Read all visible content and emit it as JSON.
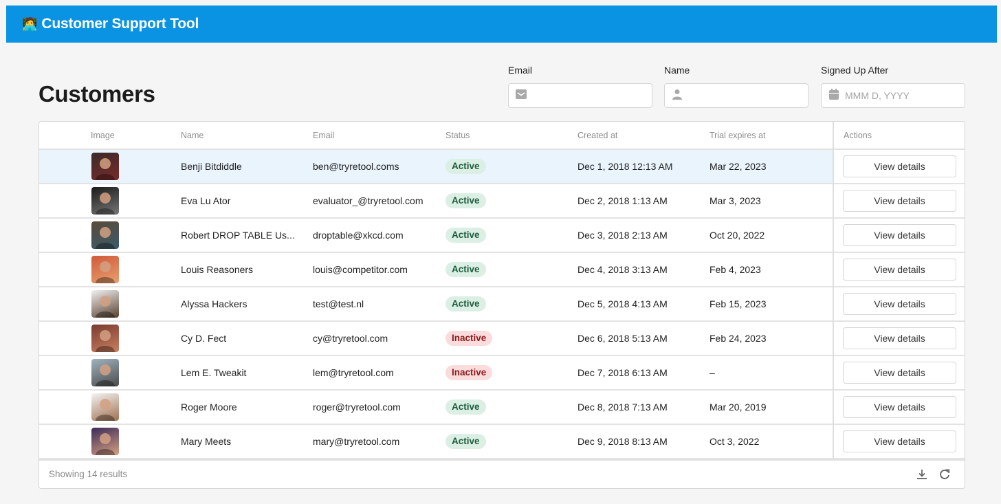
{
  "app": {
    "emoji": "🧑‍💻",
    "title": "Customer Support Tool",
    "header_color": "#0b93e3"
  },
  "page": {
    "title": "Customers"
  },
  "filters": {
    "email": {
      "label": "Email",
      "value": "",
      "placeholder": "",
      "icon": "mail-icon"
    },
    "name": {
      "label": "Name",
      "value": "",
      "placeholder": "",
      "icon": "user-icon"
    },
    "signed_up_after": {
      "label": "Signed Up After",
      "value": "",
      "placeholder": "MMM D, YYYY",
      "icon": "calendar-icon"
    }
  },
  "table": {
    "columns": {
      "image": "Image",
      "name": "Name",
      "email": "Email",
      "status": "Status",
      "created_at": "Created at",
      "trial_expires_at": "Trial expires at",
      "actions": "Actions"
    },
    "action_label": "View details",
    "rows": [
      {
        "name": "Benji Bitdiddle",
        "email": "ben@tryretool.coms",
        "status": "Active",
        "created_at": "Dec 1, 2018 12:13 AM",
        "trial_expires_at": "Mar 22, 2023",
        "selected": true
      },
      {
        "name": "Eva Lu Ator",
        "email": "evaluator_@tryretool.com",
        "status": "Active",
        "created_at": "Dec 2, 2018 1:13 AM",
        "trial_expires_at": "Mar 3, 2023"
      },
      {
        "name": "Robert DROP TABLE Us...",
        "email": "droptable@xkcd.com",
        "status": "Active",
        "created_at": "Dec 3, 2018 2:13 AM",
        "trial_expires_at": "Oct 20, 2022"
      },
      {
        "name": "Louis Reasoners",
        "email": "louis@competitor.com",
        "status": "Active",
        "created_at": "Dec 4, 2018 3:13 AM",
        "trial_expires_at": "Feb 4, 2023"
      },
      {
        "name": "Alyssa Hackers",
        "email": "test@test.nl",
        "status": "Active",
        "created_at": "Dec 5, 2018 4:13 AM",
        "trial_expires_at": "Feb 15, 2023"
      },
      {
        "name": "Cy D. Fect",
        "email": "cy@tryretool.com",
        "status": "Inactive",
        "created_at": "Dec 6, 2018 5:13 AM",
        "trial_expires_at": "Feb 24, 2023"
      },
      {
        "name": "Lem E. Tweakit",
        "email": "lem@tryretool.com",
        "status": "Inactive",
        "created_at": "Dec 7, 2018 6:13 AM",
        "trial_expires_at": "–"
      },
      {
        "name": "Roger Moore",
        "email": "roger@tryretool.com",
        "status": "Active",
        "created_at": "Dec 8, 2018 7:13 AM",
        "trial_expires_at": "Mar 20, 2019"
      },
      {
        "name": "Mary Meets",
        "email": "mary@tryretool.com",
        "status": "Active",
        "created_at": "Dec 9, 2018 8:13 AM",
        "trial_expires_at": "Oct 3, 2022"
      }
    ],
    "avatar_colors": [
      [
        "#3a2a2a",
        "#7a2a2a"
      ],
      [
        "#1a1a1a",
        "#777777"
      ],
      [
        "#5a4a3a",
        "#3a5a6a"
      ],
      [
        "#d05a3a",
        "#e8a070"
      ],
      [
        "#f0f0f0",
        "#5a4030"
      ],
      [
        "#7a3a30",
        "#c98060"
      ],
      [
        "#9fb3c0",
        "#4a4a4a"
      ],
      [
        "#f3f3f3",
        "#a07050"
      ],
      [
        "#3a2a5a",
        "#d8a080"
      ]
    ],
    "footer": {
      "count_text": "Showing 14 results",
      "download_icon": "download-icon",
      "refresh_icon": "refresh-icon"
    }
  }
}
